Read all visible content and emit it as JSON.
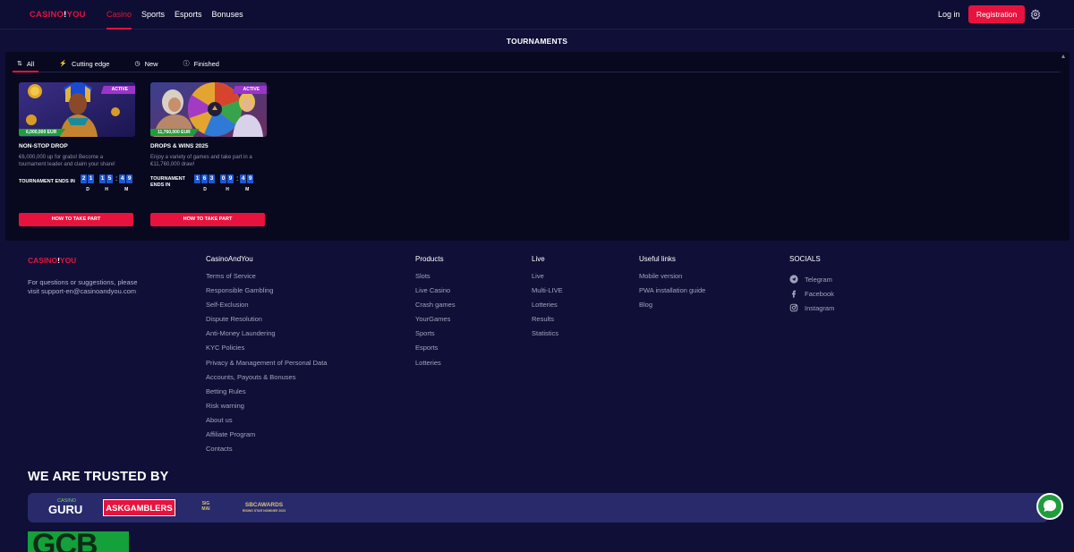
{
  "header": {
    "logo": {
      "prefix": "CASINO",
      "bang": "!",
      "suffix": "YOU"
    },
    "nav": [
      {
        "label": "Casino",
        "active": true
      },
      {
        "label": "Sports",
        "active": false
      },
      {
        "label": "Esports",
        "active": false
      },
      {
        "label": "Bonuses",
        "active": false
      }
    ],
    "login_label": "Log in",
    "register_label": "Registration",
    "settings_icon": "gear-icon"
  },
  "page_title": "TOURNAMENTS",
  "tabs": [
    {
      "label": "All",
      "icon": "sort-icon",
      "active": true
    },
    {
      "label": "Cutting edge",
      "icon": "lightning-icon",
      "active": false
    },
    {
      "label": "New",
      "icon": "clock-icon",
      "active": false
    },
    {
      "label": "Finished",
      "icon": "info-icon",
      "active": false
    }
  ],
  "tournaments": [
    {
      "badge": "ACTIVE",
      "prize": "6,000,000 EUR",
      "title": "NON-STOP DROP",
      "description": "€6,000,000 up for grabs! Become a tournament leader and claim your share!",
      "ends_label": "TOURNAMENT ENDS IN",
      "timer": {
        "days": [
          "2",
          "1"
        ],
        "hours": [
          "1",
          "5"
        ],
        "minutes": [
          "4",
          "9"
        ],
        "d": "D",
        "h": "H",
        "m": "M"
      },
      "cta": "HOW TO TAKE PART"
    },
    {
      "badge": "ACTIVE",
      "prize": "11,760,000 EUR",
      "title": "DROPS & WINS 2025",
      "description": "Enjoy a variety of games and take part in a €11,760,000 draw!",
      "ends_label_1": "TOURNAMENT",
      "ends_label_2": "ENDS IN",
      "timer": {
        "days": [
          "1",
          "6",
          "3"
        ],
        "hours": [
          "0",
          "9"
        ],
        "minutes": [
          "4",
          "9"
        ],
        "d": "D",
        "h": "H",
        "m": "M"
      },
      "cta": "HOW TO TAKE PART"
    }
  ],
  "footer": {
    "logo": {
      "prefix": "CASINO",
      "bang": "!",
      "suffix": "YOU"
    },
    "contact_line_1": "For questions or suggestions, please",
    "contact_line_2": "visit support-en@casinoandyou.com",
    "columns": [
      {
        "title": "CasinoAndYou",
        "links": [
          "Terms of Service",
          "Responsible Gambling",
          "Self-Exclusion",
          "Dispute Resolution",
          "Anti-Money Laundering",
          "KYC Policies",
          "Privacy & Management of Personal Data",
          "Accounts, Payouts & Bonuses",
          "Betting Rules",
          "Risk warning",
          "About us",
          "Affiliate Program",
          "Contacts"
        ]
      },
      {
        "title": "Products",
        "links": [
          "Slots",
          "Live Casino",
          "Crash games",
          "YourGames",
          "Sports",
          "Esports",
          "Lotteries"
        ]
      },
      {
        "title": "Live",
        "links": [
          "Live",
          "Multi-LIVE",
          "Lotteries",
          "Results",
          "Statistics"
        ]
      },
      {
        "title": "Useful links",
        "links": [
          "Mobile version",
          "PWA installation guide",
          "Blog"
        ]
      },
      {
        "title": "SOCIALS",
        "links": [
          "Telegram",
          "Facebook",
          "Instagram"
        ]
      }
    ],
    "trusted_title": "WE ARE TRUSTED BY",
    "trust_logos": {
      "guru_small": "CASINO",
      "guru_big": "GURU",
      "askgamblers": "ASKGAMBLERS",
      "sig_1": "SiG",
      "sig_2": "MAI",
      "sbc": "SBCAWARDS",
      "sbc_sub": "RISING STAR NOMINEE 2023"
    },
    "gcb": "GCB"
  },
  "colors": {
    "accent": "#e8123e",
    "background": "#0f0f37",
    "panel": "#08081f",
    "timer_digit": "#1e58d0",
    "prize_badge": "#1f9d3b",
    "active_badge": "#9b35c8"
  }
}
